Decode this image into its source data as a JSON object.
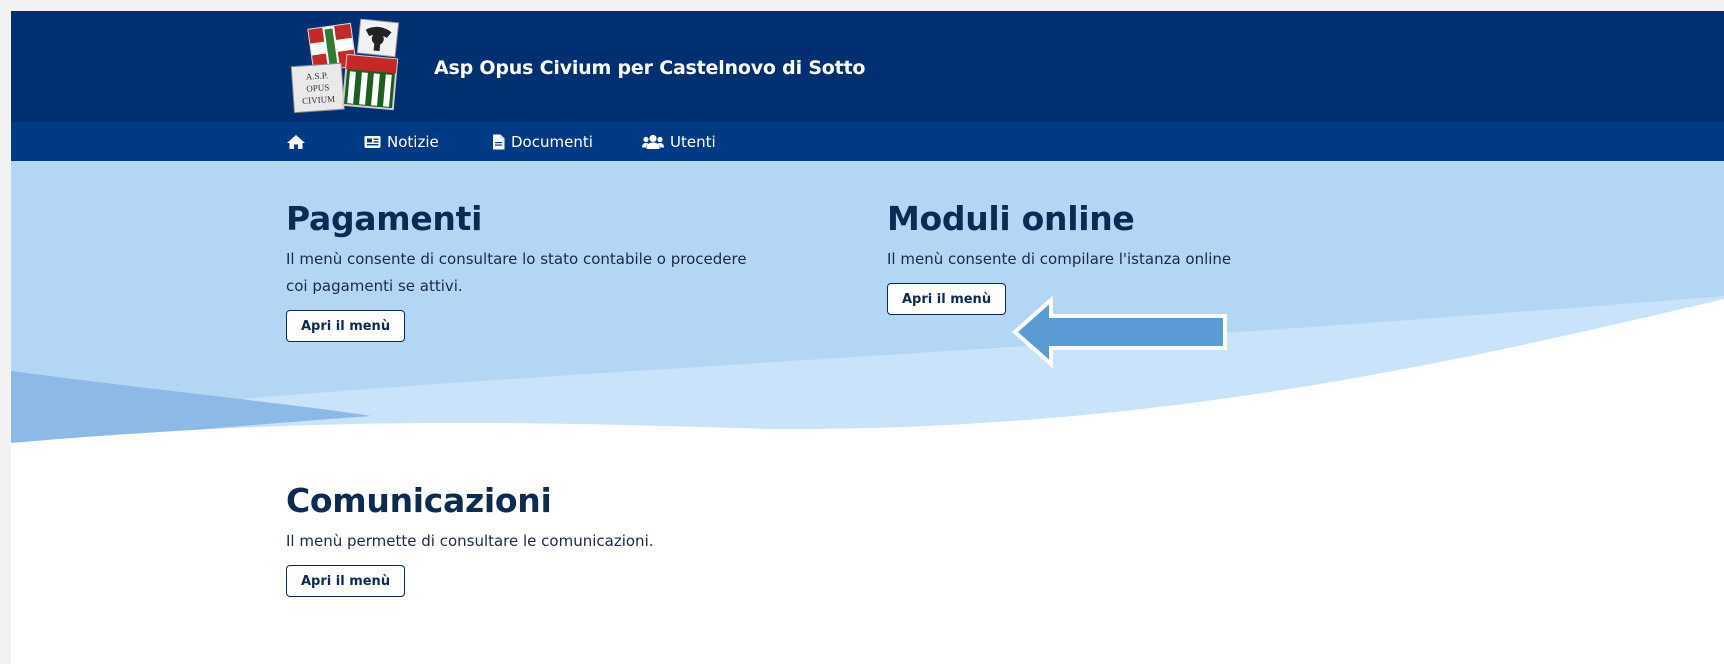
{
  "header": {
    "title": "Asp Opus Civium per Castelnovo di Sotto",
    "logo_text": [
      "A.S.P.",
      "OPUS",
      "CIVIUM"
    ]
  },
  "nav": {
    "items": [
      {
        "label": "",
        "icon": "home-icon"
      },
      {
        "label": "Notizie",
        "icon": "newspaper-icon"
      },
      {
        "label": "Documenti",
        "icon": "document-icon"
      },
      {
        "label": "Utenti",
        "icon": "users-icon"
      }
    ]
  },
  "sections": {
    "pagamenti": {
      "title": "Pagamenti",
      "description_line1": "Il menù consente di consultare lo stato contabile o procedere",
      "description_line2": "coi pagamenti se attivi.",
      "button": "Apri il menù"
    },
    "moduli": {
      "title": "Moduli online",
      "description": "Il menù consente di compilare l'istanza online",
      "button": "Apri il menù"
    },
    "comunicazioni": {
      "title": "Comunicazioni",
      "description": "Il menù permette di consultare le comunicazioni.",
      "button": "Apri il menù"
    }
  },
  "annotation": {
    "arrow_direction": "left",
    "arrow_color": "#5b9bd5"
  },
  "colors": {
    "header_bg": "#003072",
    "nav_bg": "#003a85",
    "hero_bg": "#b3d6f5",
    "title_color": "#0c2a52"
  }
}
